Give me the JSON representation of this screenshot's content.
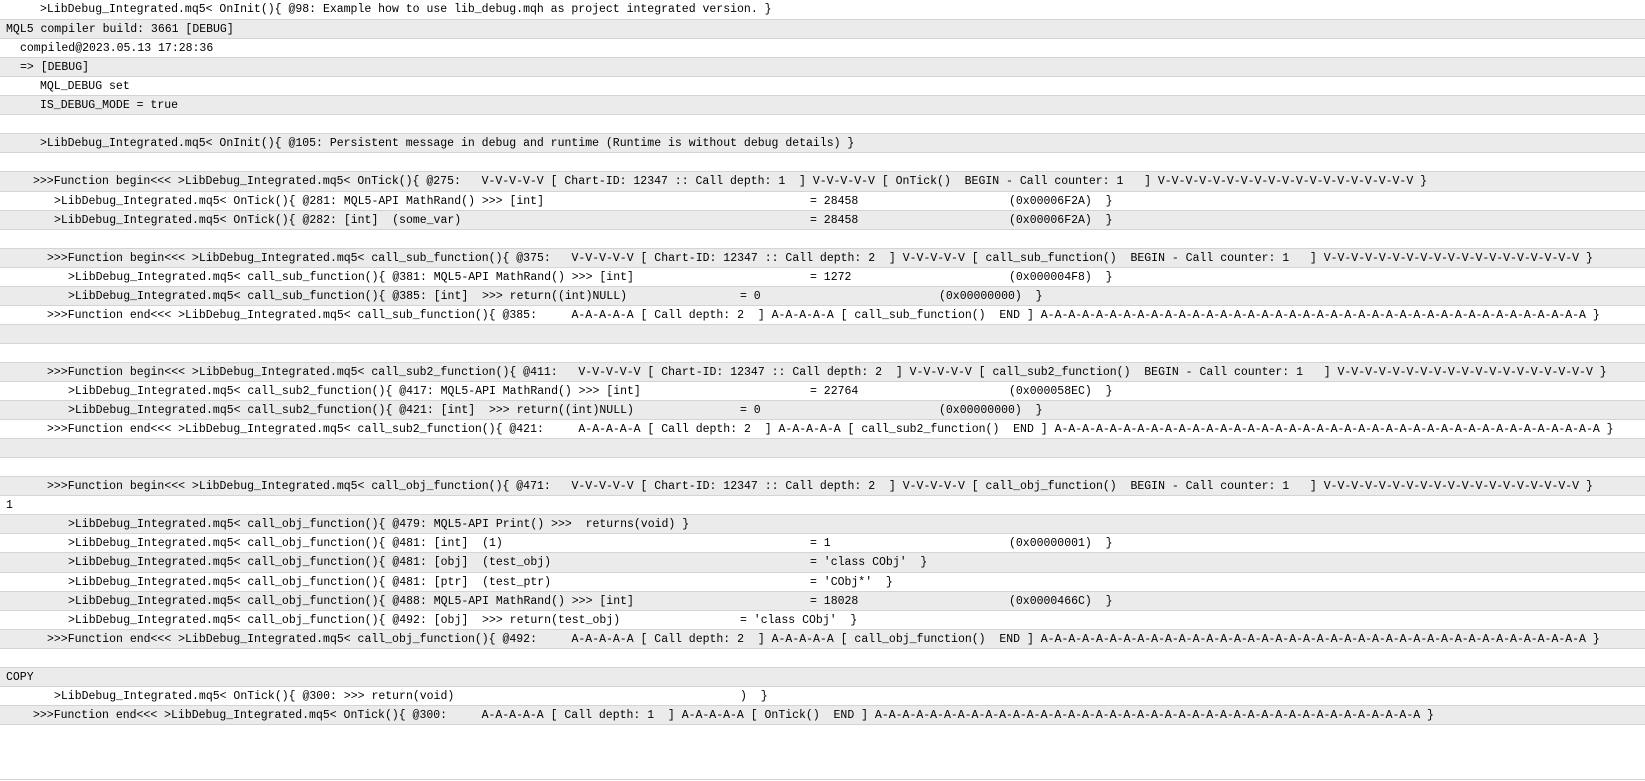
{
  "log": {
    "lines": [
      [
        [
          40,
          ">LibDebug_Integrated.mq5< OnInit(){ @98: Example how to use lib_debug.mqh as project integrated version. }"
        ]
      ],
      [
        [
          6,
          "MQL5 compiler build: 3661 [DEBUG]"
        ]
      ],
      [
        [
          20,
          "compiled@2023.05.13 17:28:36"
        ]
      ],
      [
        [
          20,
          "=> [DEBUG]"
        ]
      ],
      [
        [
          40,
          "MQL_DEBUG set"
        ]
      ],
      [
        [
          40,
          "IS_DEBUG_MODE = true"
        ]
      ],
      [],
      [
        [
          40,
          ">LibDebug_Integrated.mq5< OnInit(){ @105: Persistent message in debug and runtime (Runtime is without debug details) }"
        ]
      ],
      [],
      [
        [
          33,
          ">>>Function begin<<< >LibDebug_Integrated.mq5< OnTick(){ @275:   V-V-V-V-V [ Chart-ID: 12347 :: Call depth: 1  ] V-V-V-V-V [ OnTick()  BEGIN - Call counter: 1   ] V-V-V-V-V-V-V-V-V-V-V-V-V-V-V-V-V-V-V }"
        ]
      ],
      [
        [
          54,
          ">LibDebug_Integrated.mq5< OnTick(){ @281: MQL5-API MathRand() >>> [int]"
        ],
        [
          810,
          "= 28458"
        ],
        [
          1009,
          "(0x00006F2A)  }"
        ]
      ],
      [
        [
          54,
          ">LibDebug_Integrated.mq5< OnTick(){ @282: [int]  (some_var)"
        ],
        [
          810,
          "= 28458"
        ],
        [
          1009,
          "(0x00006F2A)  }"
        ]
      ],
      [],
      [
        [
          47,
          ">>>Function begin<<< >LibDebug_Integrated.mq5< call_sub_function(){ @375:   V-V-V-V-V [ Chart-ID: 12347 :: Call depth: 2  ] V-V-V-V-V [ call_sub_function()  BEGIN - Call counter: 1   ] V-V-V-V-V-V-V-V-V-V-V-V-V-V-V-V-V-V-V }"
        ]
      ],
      [
        [
          68,
          ">LibDebug_Integrated.mq5< call_sub_function(){ @381: MQL5-API MathRand() >>> [int]"
        ],
        [
          810,
          "= 1272"
        ],
        [
          1009,
          "(0x000004F8)  }"
        ]
      ],
      [
        [
          68,
          ">LibDebug_Integrated.mq5< call_sub_function(){ @385: [int]  >>> return((int)NULL)"
        ],
        [
          740,
          "= 0"
        ],
        [
          939,
          "(0x00000000)  }"
        ]
      ],
      [
        [
          47,
          ">>>Function end<<< >LibDebug_Integrated.mq5< call_sub_function(){ @385:     A-A-A-A-A [ Call depth: 2  ] A-A-A-A-A [ call_sub_function()  END ] A-A-A-A-A-A-A-A-A-A-A-A-A-A-A-A-A-A-A-A-A-A-A-A-A-A-A-A-A-A-A-A-A-A-A-A-A-A-A-A }"
        ]
      ],
      [],
      [],
      [
        [
          47,
          ">>>Function begin<<< >LibDebug_Integrated.mq5< call_sub2_function(){ @411:   V-V-V-V-V [ Chart-ID: 12347 :: Call depth: 2  ] V-V-V-V-V [ call_sub2_function()  BEGIN - Call counter: 1   ] V-V-V-V-V-V-V-V-V-V-V-V-V-V-V-V-V-V-V }"
        ]
      ],
      [
        [
          68,
          ">LibDebug_Integrated.mq5< call_sub2_function(){ @417: MQL5-API MathRand() >>> [int]"
        ],
        [
          810,
          "= 22764"
        ],
        [
          1009,
          "(0x000058EC)  }"
        ]
      ],
      [
        [
          68,
          ">LibDebug_Integrated.mq5< call_sub2_function(){ @421: [int]  >>> return((int)NULL)"
        ],
        [
          740,
          "= 0"
        ],
        [
          939,
          "(0x00000000)  }"
        ]
      ],
      [
        [
          47,
          ">>>Function end<<< >LibDebug_Integrated.mq5< call_sub2_function(){ @421:     A-A-A-A-A [ Call depth: 2  ] A-A-A-A-A [ call_sub2_function()  END ] A-A-A-A-A-A-A-A-A-A-A-A-A-A-A-A-A-A-A-A-A-A-A-A-A-A-A-A-A-A-A-A-A-A-A-A-A-A-A-A }"
        ]
      ],
      [],
      [],
      [
        [
          47,
          ">>>Function begin<<< >LibDebug_Integrated.mq5< call_obj_function(){ @471:   V-V-V-V-V [ Chart-ID: 12347 :: Call depth: 2  ] V-V-V-V-V [ call_obj_function()  BEGIN - Call counter: 1   ] V-V-V-V-V-V-V-V-V-V-V-V-V-V-V-V-V-V-V }"
        ]
      ],
      [
        [
          6,
          "1"
        ]
      ],
      [
        [
          68,
          ">LibDebug_Integrated.mq5< call_obj_function(){ @479: MQL5-API Print() >>>  returns(void) }"
        ]
      ],
      [
        [
          68,
          ">LibDebug_Integrated.mq5< call_obj_function(){ @481: [int]  (1)"
        ],
        [
          810,
          "= 1"
        ],
        [
          1009,
          "(0x00000001)  }"
        ]
      ],
      [
        [
          68,
          ">LibDebug_Integrated.mq5< call_obj_function(){ @481: [obj]  (test_obj)"
        ],
        [
          810,
          "= 'class CObj'  }"
        ]
      ],
      [
        [
          68,
          ">LibDebug_Integrated.mq5< call_obj_function(){ @481: [ptr]  (test_ptr)"
        ],
        [
          810,
          "= 'CObj*'  }"
        ]
      ],
      [
        [
          68,
          ">LibDebug_Integrated.mq5< call_obj_function(){ @488: MQL5-API MathRand() >>> [int]"
        ],
        [
          810,
          "= 18028"
        ],
        [
          1009,
          "(0x0000466C)  }"
        ]
      ],
      [
        [
          68,
          ">LibDebug_Integrated.mq5< call_obj_function(){ @492: [obj]  >>> return(test_obj)"
        ],
        [
          740,
          "= 'class CObj'  }"
        ]
      ],
      [
        [
          47,
          ">>>Function end<<< >LibDebug_Integrated.mq5< call_obj_function(){ @492:     A-A-A-A-A [ Call depth: 2  ] A-A-A-A-A [ call_obj_function()  END ] A-A-A-A-A-A-A-A-A-A-A-A-A-A-A-A-A-A-A-A-A-A-A-A-A-A-A-A-A-A-A-A-A-A-A-A-A-A-A-A }"
        ]
      ],
      [],
      [
        [
          6,
          "COPY"
        ]
      ],
      [
        [
          54,
          ">LibDebug_Integrated.mq5< OnTick(){ @300: >>> return(void)"
        ],
        [
          740,
          ")  }"
        ]
      ],
      [
        [
          33,
          ">>>Function end<<< >LibDebug_Integrated.mq5< OnTick(){ @300:     A-A-A-A-A [ Call depth: 1  ] A-A-A-A-A [ OnTick()  END ] A-A-A-A-A-A-A-A-A-A-A-A-A-A-A-A-A-A-A-A-A-A-A-A-A-A-A-A-A-A-A-A-A-A-A-A-A-A-A-A }"
        ]
      ],
      []
    ]
  }
}
